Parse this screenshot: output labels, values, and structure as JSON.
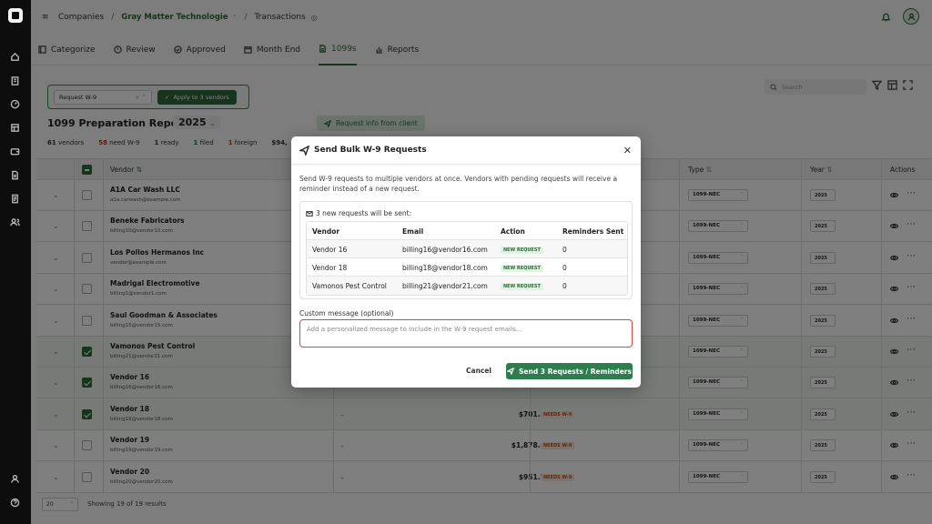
{
  "topbar": {
    "companies": "Companies",
    "org": "Gray Matter Technologie",
    "page": "Transactions"
  },
  "tabs": [
    {
      "label": "Categorize",
      "icon": "categorize-icon"
    },
    {
      "label": "Review",
      "icon": "review-icon"
    },
    {
      "label": "Approved",
      "icon": "approved-icon"
    },
    {
      "label": "Month End",
      "icon": "calendar-icon"
    },
    {
      "label": "1099s",
      "icon": "document-icon"
    },
    {
      "label": "Reports",
      "icon": "chart-icon"
    }
  ],
  "filter": {
    "select_value": "Request W-9",
    "apply_label": "Apply to 3 vendors"
  },
  "search": {
    "placeholder": "Search"
  },
  "report": {
    "title": "1099 Preparation Report for",
    "year": "2025",
    "request_button": "Request info from client"
  },
  "stats": [
    {
      "value": "61",
      "label": "vendors",
      "tone": ""
    },
    {
      "value": "58",
      "label": "need W-9",
      "tone": "red"
    },
    {
      "value": "1",
      "label": "ready",
      "tone": ""
    },
    {
      "value": "1",
      "label": "filed",
      "tone": "grn"
    },
    {
      "value": "1",
      "label": "foreign",
      "tone": "org"
    },
    {
      "value": "$94,",
      "label": "",
      "tone": ""
    }
  ],
  "table": {
    "headers": {
      "vendor": "Vendor",
      "type": "Type",
      "year": "Year",
      "actions": "Actions"
    },
    "rows": [
      {
        "name": "A1A Car Wash LLC",
        "email": "a1a.carwash@example.com",
        "checked": false,
        "dash": "",
        "amount": "",
        "badge": "",
        "type": "1099-NEC",
        "year": "2025"
      },
      {
        "name": "Beneke Fabricators",
        "email": "billing10@vendor10.com",
        "checked": false,
        "dash": "",
        "amount": "",
        "badge": "",
        "type": "1099-NEC",
        "year": "2025"
      },
      {
        "name": "Los Pollos Hermanos Inc",
        "email": "vendor@example.com",
        "checked": false,
        "dash": "",
        "amount": "",
        "badge": "",
        "type": "1099-NEC",
        "year": "2025"
      },
      {
        "name": "Madrigal Electromotive",
        "email": "billing1@vendor1.com",
        "checked": false,
        "dash": "",
        "amount": "",
        "badge": "",
        "type": "1099-NEC",
        "year": "2025"
      },
      {
        "name": "Saul Goodman & Associates",
        "email": "billing15@vendor15.com",
        "checked": false,
        "dash": "",
        "amount": "",
        "badge": "",
        "type": "1099-NEC",
        "year": "2025"
      },
      {
        "name": "Vamonos Pest Control",
        "email": "billing21@vendor21.com",
        "checked": true,
        "dash": "",
        "amount": "",
        "badge": "",
        "type": "1099-NEC",
        "year": "2025"
      },
      {
        "name": "Vendor 16",
        "email": "billing16@vendor16.com",
        "checked": true,
        "dash": "",
        "amount": "",
        "badge": "",
        "type": "1099-NEC",
        "year": "2025"
      },
      {
        "name": "Vendor 18",
        "email": "billing18@vendor18.com",
        "checked": true,
        "dash": "–",
        "amount": "$701.42",
        "badge": "NEEDS W-9",
        "type": "1099-NEC",
        "year": "2025"
      },
      {
        "name": "Vendor 19",
        "email": "billing19@vendor19.com",
        "checked": false,
        "dash": "–",
        "amount": "$1,878.44",
        "badge": "NEEDS W-9",
        "type": "1099-NEC",
        "year": "2025"
      },
      {
        "name": "Vendor 20",
        "email": "billing20@vendor20.com",
        "checked": false,
        "dash": "–",
        "amount": "$951.74",
        "badge": "NEEDS W-9",
        "type": "1099-NEC",
        "year": "2025"
      }
    ]
  },
  "footer": {
    "page_size": "20",
    "summary": "Showing 19 of 19 results"
  },
  "modal": {
    "title": "Send Bulk W-9 Requests",
    "description": "Send W-9 requests to multiple vendors at once. Vendors with pending requests will receive a reminder instead of a new request.",
    "count_text": "3 new requests will be sent:",
    "headers": {
      "vendor": "Vendor",
      "email": "Email",
      "action": "Action",
      "reminders": "Reminders Sent"
    },
    "rows": [
      {
        "vendor": "Vendor 16",
        "email": "billing16@vendor16.com",
        "action": "NEW REQUEST",
        "reminders": "0"
      },
      {
        "vendor": "Vendor 18",
        "email": "billing18@vendor18.com",
        "action": "NEW REQUEST",
        "reminders": "0"
      },
      {
        "vendor": "Vamonos Pest Control",
        "email": "billing21@vendor21.com",
        "action": "NEW REQUEST",
        "reminders": "0"
      }
    ],
    "custom_label": "Custom message (optional)",
    "custom_placeholder": "Add a personalized message to include in the W-9 request emails...",
    "cancel_label": "Cancel",
    "send_label": "Send 3 Requests / Reminders"
  }
}
